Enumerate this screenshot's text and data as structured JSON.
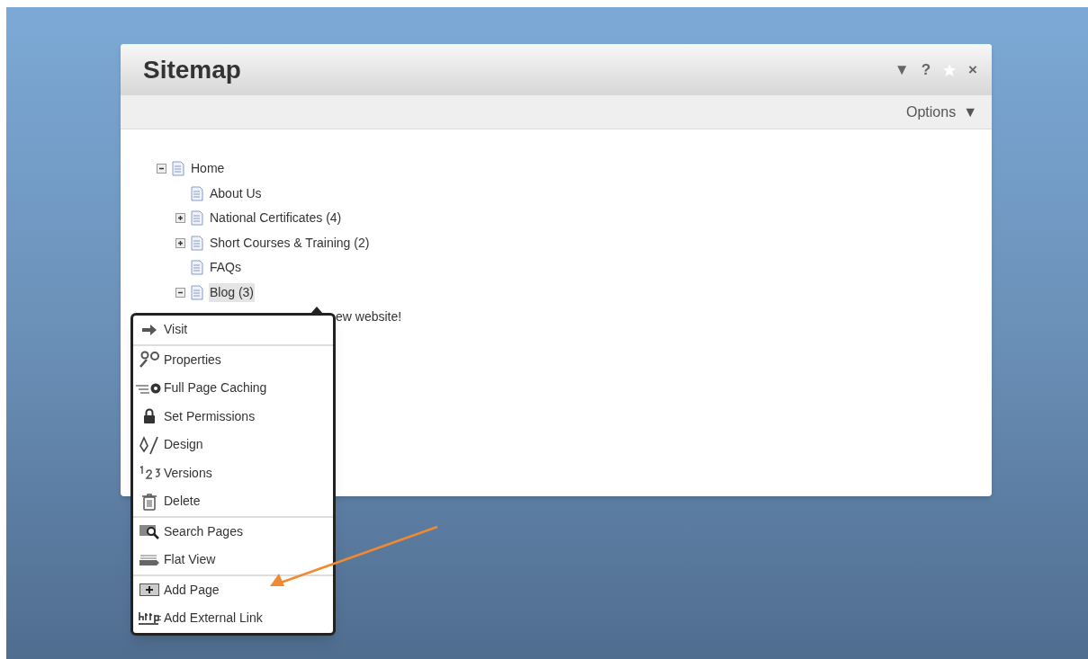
{
  "panel": {
    "title": "Sitemap",
    "controls": [
      "▼",
      "?",
      "×"
    ],
    "options": {
      "label": "Options",
      "caret": "▼"
    }
  },
  "tree": [
    {
      "label": "Home",
      "kind": "folder",
      "expanded": true,
      "selected": false,
      "children": [
        {
          "label": "About Us",
          "kind": "page",
          "selected": false
        },
        {
          "label": "National Certificates (4)",
          "kind": "folder",
          "expanded": false,
          "selected": false
        },
        {
          "label": "Short Courses & Training (2)",
          "kind": "folder",
          "expanded": false,
          "selected": false
        },
        {
          "label": "FAQs",
          "kind": "page",
          "selected": false
        },
        {
          "label": "Blog (3)",
          "kind": "folder",
          "expanded": true,
          "selected": true,
          "children": [
            {
              "label": "ew website!",
              "kind": "covered"
            }
          ]
        }
      ]
    }
  ],
  "context_menu": {
    "sections": [
      [
        "Visit"
      ],
      [
        "Properties",
        "Full Page Caching",
        "Set Permissions",
        "Design",
        "Versions",
        "Delete"
      ],
      [
        "Search Pages",
        "Flat View"
      ],
      [
        "Add Page",
        "Add External Link"
      ]
    ]
  }
}
